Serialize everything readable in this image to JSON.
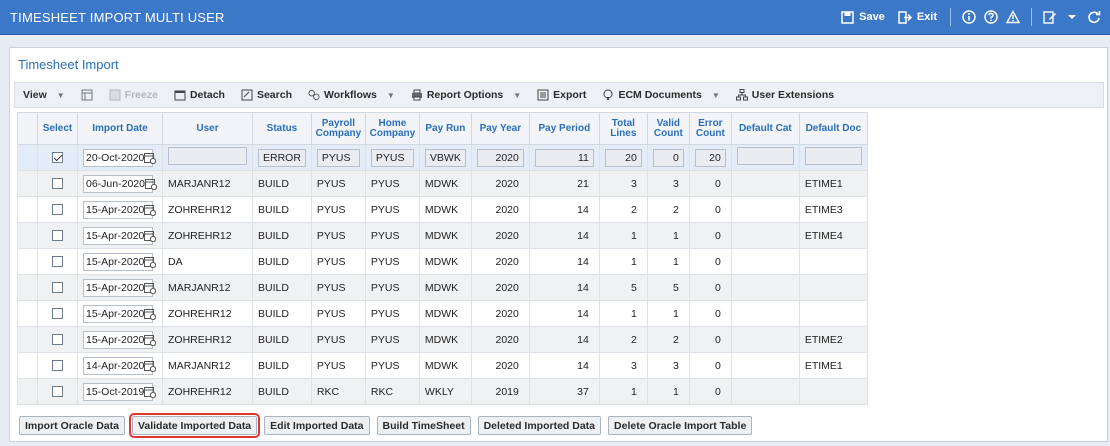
{
  "window": {
    "title": "TIMESHEET IMPORT MULTI USER",
    "save_label": "Save",
    "exit_label": "Exit",
    "icons": [
      "save-icon",
      "exit-icon",
      "info-icon",
      "help-icon",
      "warning-icon",
      "edit-icon",
      "chevron-down-icon",
      "refresh-icon"
    ]
  },
  "panel": {
    "title": "Timesheet Import"
  },
  "toolbar": {
    "view": "View",
    "freeze": "Freeze",
    "detach": "Detach",
    "search": "Search",
    "workflows": "Workflows",
    "report_options": "Report Options",
    "export": "Export",
    "ecm_documents": "ECM Documents",
    "user_extensions": "User Extensions"
  },
  "grid": {
    "headers": [
      "Select",
      "Import Date",
      "User",
      "Status",
      "Payroll Company",
      "Home Company",
      "Pay Run",
      "Pay Year",
      "Pay Period",
      "Total Lines",
      "Valid Count",
      "Error Count",
      "Default Cat",
      "Default Doc"
    ],
    "filter_row": {
      "checked": true,
      "import_date": "20-Oct-2020",
      "user": "",
      "status": "ERROR",
      "payroll_company": "PYUS",
      "home_company": "PYUS",
      "pay_run": "VBWK",
      "pay_year": "2020",
      "pay_period": "11",
      "total_lines": "20",
      "valid_count": "0",
      "error_count": "20",
      "default_cat": "",
      "default_doc": ""
    },
    "rows": [
      {
        "import_date": "06-Jun-2020",
        "user": "MARJANR12",
        "status": "BUILD",
        "payroll_company": "PYUS",
        "home_company": "PYUS",
        "pay_run": "MDWK",
        "pay_year": "2020",
        "pay_period": "21",
        "total_lines": "3",
        "valid_count": "3",
        "error_count": "0",
        "default_cat": "",
        "default_doc": "ETIME1"
      },
      {
        "import_date": "15-Apr-2020",
        "user": "ZOHREHR12",
        "status": "BUILD",
        "payroll_company": "PYUS",
        "home_company": "PYUS",
        "pay_run": "MDWK",
        "pay_year": "2020",
        "pay_period": "14",
        "total_lines": "2",
        "valid_count": "2",
        "error_count": "0",
        "default_cat": "",
        "default_doc": "ETIME3"
      },
      {
        "import_date": "15-Apr-2020",
        "user": "ZOHREHR12",
        "status": "BUILD",
        "payroll_company": "PYUS",
        "home_company": "PYUS",
        "pay_run": "MDWK",
        "pay_year": "2020",
        "pay_period": "14",
        "total_lines": "1",
        "valid_count": "1",
        "error_count": "0",
        "default_cat": "",
        "default_doc": "ETIME4"
      },
      {
        "import_date": "15-Apr-2020",
        "user": "DA",
        "status": "BUILD",
        "payroll_company": "PYUS",
        "home_company": "PYUS",
        "pay_run": "MDWK",
        "pay_year": "2020",
        "pay_period": "14",
        "total_lines": "1",
        "valid_count": "1",
        "error_count": "0",
        "default_cat": "",
        "default_doc": ""
      },
      {
        "import_date": "15-Apr-2020",
        "user": "MARJANR12",
        "status": "BUILD",
        "payroll_company": "PYUS",
        "home_company": "PYUS",
        "pay_run": "MDWK",
        "pay_year": "2020",
        "pay_period": "14",
        "total_lines": "5",
        "valid_count": "5",
        "error_count": "0",
        "default_cat": "",
        "default_doc": ""
      },
      {
        "import_date": "15-Apr-2020",
        "user": "ZOHREHR12",
        "status": "BUILD",
        "payroll_company": "PYUS",
        "home_company": "PYUS",
        "pay_run": "MDWK",
        "pay_year": "2020",
        "pay_period": "14",
        "total_lines": "1",
        "valid_count": "1",
        "error_count": "0",
        "default_cat": "",
        "default_doc": ""
      },
      {
        "import_date": "15-Apr-2020",
        "user": "ZOHREHR12",
        "status": "BUILD",
        "payroll_company": "PYUS",
        "home_company": "PYUS",
        "pay_run": "MDWK",
        "pay_year": "2020",
        "pay_period": "14",
        "total_lines": "2",
        "valid_count": "2",
        "error_count": "0",
        "default_cat": "",
        "default_doc": "ETIME2"
      },
      {
        "import_date": "14-Apr-2020",
        "user": "MARJANR12",
        "status": "BUILD",
        "payroll_company": "PYUS",
        "home_company": "PYUS",
        "pay_run": "MDWK",
        "pay_year": "2020",
        "pay_period": "14",
        "total_lines": "3",
        "valid_count": "3",
        "error_count": "0",
        "default_cat": "",
        "default_doc": "ETIME1"
      },
      {
        "import_date": "15-Oct-2019",
        "user": "ZOHREHR12",
        "status": "BUILD",
        "payroll_company": "RKC",
        "home_company": "RKC",
        "pay_run": "WKLY",
        "pay_year": "2019",
        "pay_period": "37",
        "total_lines": "1",
        "valid_count": "1",
        "error_count": "0",
        "default_cat": "",
        "default_doc": ""
      }
    ]
  },
  "buttons": {
    "import_oracle": "Import Oracle Data",
    "validate": "Validate Imported Data",
    "edit": "Edit Imported Data",
    "build": "Build TimeSheet",
    "deleted": "Deleted Imported Data",
    "delete_table": "Delete Oracle Import Table"
  },
  "colors": {
    "header_bar": "#3c78c8",
    "accent_text": "#2a6fb8",
    "highlight": "#e03535"
  }
}
